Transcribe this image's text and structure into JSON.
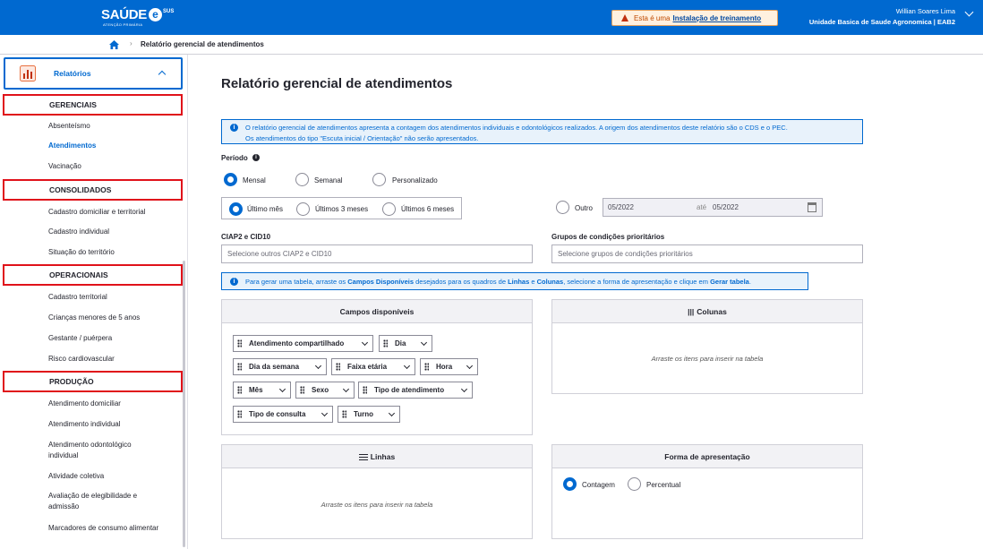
{
  "header": {
    "logo_main": "SAÚDE",
    "logo_e": "e",
    "logo_sus": "SUS",
    "logo_sub": "ATENÇÃO PRIMÁRIA",
    "training_prefix": "Esta é uma",
    "training_link": "Instalação de treinamento",
    "user_name": "Willian Soares Lima",
    "user_unit": "Unidade Basica de Saude Agronomica | EAB2"
  },
  "breadcrumb": {
    "separator": "›",
    "current": "Relatório gerencial de atendimentos"
  },
  "sidebar": {
    "menu_label": "Relatórios",
    "sections": [
      {
        "title": "GERENCIAIS",
        "items": [
          "Absenteísmo",
          "Atendimentos",
          "Vacinação"
        ]
      },
      {
        "title": "CONSOLIDADOS",
        "items": [
          "Cadastro domiciliar e territorial",
          "Cadastro individual",
          "Situação do território"
        ]
      },
      {
        "title": "OPERACIONAIS",
        "items": [
          "Cadastro territorial",
          "Crianças menores de 5 anos",
          "Gestante / puérpera",
          "Risco cardiovascular"
        ]
      },
      {
        "title": "PRODUÇÃO",
        "items": [
          "Atendimento domiciliar",
          "Atendimento individual",
          "Atendimento odontológico individual",
          "Atividade coletiva",
          "Avaliação de elegibilidade e admissão",
          "Marcadores de consumo alimentar"
        ]
      }
    ]
  },
  "main": {
    "title": "Relatório gerencial de atendimentos",
    "info_line1": "O relatório gerencial de atendimentos apresenta a contagem dos atendimentos individuais e odontológicos realizados. A origem dos atendimentos deste relatório são o CDS e o PEC.",
    "info_line2": "Os atendimentos do tipo \"Escuta inicial / Orientação\" não serão apresentados.",
    "periodo_label": "Período",
    "period_types": [
      "Mensal",
      "Semanal",
      "Personalizado"
    ],
    "period_ranges": [
      "Último mês",
      "Últimos 3 meses",
      "Últimos 6 meses"
    ],
    "outro_label": "Outro",
    "date_from": "05/2022",
    "date_sep": "até",
    "date_to": "05/2022",
    "ciap_label": "CIAP2 e CID10",
    "ciap_placeholder": "Selecione outros CIAP2 e CID10",
    "grupos_label": "Grupos de condições prioritários",
    "grupos_placeholder": "Selecione grupos de condições prioritários",
    "info2_a": "Para gerar uma tabela, arraste os ",
    "info2_b": "Campos Disponíveis",
    "info2_c": " desejados para os quadros de ",
    "info2_d": "Linhas",
    "info2_e": " e ",
    "info2_f": "Colunas",
    "info2_g": ", selecione a forma de apresentação e clique em ",
    "info2_h": "Gerar tabela",
    "info2_i": ".",
    "campos_title": "Campos disponíveis",
    "campos": [
      "Atendimento compartilhado",
      "Dia",
      "Dia da semana",
      "Faixa etária",
      "Hora",
      "Mês",
      "Sexo",
      "Tipo de atendimento",
      "Tipo de consulta",
      "Turno"
    ],
    "colunas_icon": "|||",
    "colunas_title": "Colunas",
    "linhas_title": "Linhas",
    "drop_hint": "Arraste os itens para inserir na tabela",
    "forma_title": "Forma de apresentação",
    "forma_options": [
      "Contagem",
      "Percentual"
    ]
  },
  "colors": {
    "primary": "#0069d0",
    "highlight": "#e0121a",
    "warning_bg": "#fff1e0"
  }
}
